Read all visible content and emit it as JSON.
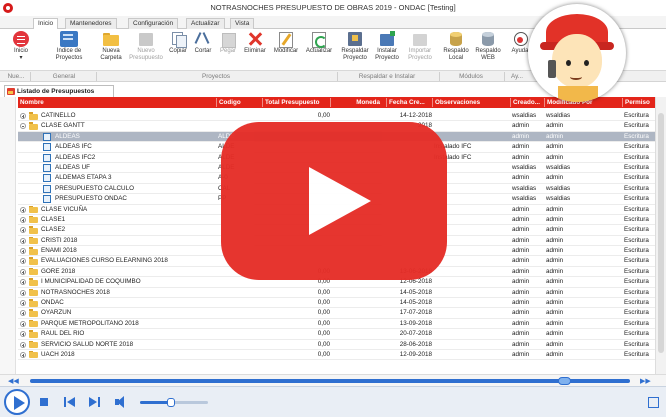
{
  "window": {
    "title": "NOTRASNOCHES PRESUPUESTO DE OBRAS 2019 - ONDAC [Testing]"
  },
  "tabs": [
    "Inicio",
    "Mantenedores",
    "Configuración",
    "Actualizar",
    "Vista"
  ],
  "ribbon": [
    {
      "label": "Inicio",
      "sub": "▾",
      "icon": "menu-circle-icon",
      "enabled": true
    },
    {
      "label": "Indice de",
      "sub": "Proyectos",
      "icon": "book-index-icon",
      "enabled": true
    },
    {
      "label": "Nueva",
      "sub": "Carpeta",
      "icon": "folder-icon",
      "enabled": true
    },
    {
      "label": "Nuevo",
      "sub": "Presupuesto",
      "icon": "new-budget-icon",
      "enabled": false
    },
    {
      "label": "Copiar",
      "sub": "",
      "icon": "copy-icon",
      "enabled": true
    },
    {
      "label": "Cortar",
      "sub": "",
      "icon": "scissors-icon",
      "enabled": true
    },
    {
      "label": "Pegar",
      "sub": "",
      "icon": "paste-icon",
      "enabled": false
    },
    {
      "label": "Eliminar",
      "sub": "",
      "icon": "delete-icon",
      "enabled": true
    },
    {
      "label": "Modificar",
      "sub": "",
      "icon": "edit-icon",
      "enabled": true
    },
    {
      "label": "Actualizar",
      "sub": "",
      "icon": "refresh-icon",
      "enabled": true
    },
    {
      "label": "Respaldar",
      "sub": "Proyecto",
      "icon": "backup-project-icon",
      "enabled": true
    },
    {
      "label": "Instalar",
      "sub": "Proyecto",
      "icon": "install-project-icon",
      "enabled": true
    },
    {
      "label": "Importar",
      "sub": "Proyecto",
      "icon": "import-project-icon",
      "enabled": false
    },
    {
      "label": "Respaldo",
      "sub": "Local",
      "icon": "local-backup-icon",
      "enabled": true
    },
    {
      "label": "Respaldo",
      "sub": "WEB",
      "icon": "web-backup-icon",
      "enabled": true
    },
    {
      "label": "Ayuda",
      "sub": "",
      "icon": "help-icon",
      "enabled": true
    }
  ],
  "groups": [
    "Nue...",
    "General",
    "Proyectos",
    "Respaldar e Instalar",
    "Módulos",
    "Ay..."
  ],
  "doc_tab": "Listado de Presupuestos",
  "columns": [
    "Nombre",
    "Codigo",
    "Total Presupuesto",
    "Moneda",
    "Fecha Cre...",
    "Observaciones",
    "Creado...",
    "Modificado Por",
    "Permiso"
  ],
  "rows": [
    {
      "name": "CATINELLO",
      "kind": "folder",
      "expander": "plus",
      "level": 0,
      "code": "",
      "total": "0,00",
      "moneda": "",
      "fecha": "14-12-2018",
      "obs": "",
      "creado": "wsaldias",
      "modificado": "wsaldias",
      "permiso": "Escritura"
    },
    {
      "name": "CLASE GANTT",
      "kind": "folder",
      "expander": "minus",
      "level": 0,
      "code": "",
      "total": "",
      "moneda": "",
      "fecha": "2018",
      "obs": "",
      "creado": "admin",
      "modificado": "admin",
      "permiso": "Escritura"
    },
    {
      "name": "ALDEAS",
      "kind": "doc",
      "expander": "",
      "level": 1,
      "code": "ALDE",
      "total": "",
      "moneda": "",
      "fecha": "",
      "obs": "",
      "creado": "admin",
      "modificado": "admin",
      "permiso": "Escritura",
      "selected": true
    },
    {
      "name": "ALDEAS IFC",
      "kind": "doc",
      "expander": "",
      "level": 1,
      "code": "ALDE",
      "total": "",
      "moneda": "",
      "fecha": "",
      "obs": "Instalado IFC",
      "creado": "admin",
      "modificado": "admin",
      "permiso": "Escritura"
    },
    {
      "name": "ALDEAS IFC2",
      "kind": "doc",
      "expander": "",
      "level": 1,
      "code": "ALDE",
      "total": "",
      "moneda": "",
      "fecha": "",
      "obs": "Instalado IFC",
      "creado": "admin",
      "modificado": "admin",
      "permiso": "Escritura"
    },
    {
      "name": "ALDEAS UF",
      "kind": "doc",
      "expander": "",
      "level": 1,
      "code": "ALDE",
      "total": "",
      "moneda": "",
      "fecha": "",
      "obs": "",
      "creado": "wsaldias",
      "modificado": "wsaldias",
      "permiso": "Escritura"
    },
    {
      "name": "ALDEMAS ETAPA 3",
      "kind": "doc",
      "expander": "",
      "level": 1,
      "code": "A-0",
      "total": "",
      "moneda": "",
      "fecha": "",
      "obs": "",
      "creado": "admin",
      "modificado": "admin",
      "permiso": "Escritura"
    },
    {
      "name": "PRESUPUESTO CALCULO",
      "kind": "doc",
      "expander": "",
      "level": 1,
      "code": "CAL",
      "total": "",
      "moneda": "",
      "fecha": "",
      "obs": "",
      "creado": "wsaldias",
      "modificado": "wsaldias",
      "permiso": "Escritura"
    },
    {
      "name": "PRESUPUESTO ONDAC",
      "kind": "doc",
      "expander": "",
      "level": 1,
      "code": "PP",
      "total": "",
      "moneda": "",
      "fecha": "",
      "obs": "",
      "creado": "wsaldias",
      "modificado": "wsaldias",
      "permiso": "Escritura"
    },
    {
      "name": "CLASE VICUÑA",
      "kind": "folder",
      "expander": "plus",
      "level": 0,
      "code": "",
      "total": "",
      "moneda": "",
      "fecha": "",
      "obs": "",
      "creado": "admin",
      "modificado": "admin",
      "permiso": "Escritura"
    },
    {
      "name": "CLASE1",
      "kind": "folder",
      "expander": "plus",
      "level": 0,
      "code": "",
      "total": "",
      "moneda": "",
      "fecha": "",
      "obs": "",
      "creado": "admin",
      "modificado": "admin",
      "permiso": "Escritura"
    },
    {
      "name": "CLASE2",
      "kind": "folder",
      "expander": "plus",
      "level": 0,
      "code": "",
      "total": "",
      "moneda": "",
      "fecha": "",
      "obs": "",
      "creado": "admin",
      "modificado": "admin",
      "permiso": "Escritura"
    },
    {
      "name": "CRISTI 2018",
      "kind": "folder",
      "expander": "plus",
      "level": 0,
      "code": "",
      "total": "",
      "moneda": "",
      "fecha": "",
      "obs": "",
      "creado": "admin",
      "modificado": "admin",
      "permiso": "Escritura"
    },
    {
      "name": "ENAMI 2018",
      "kind": "folder",
      "expander": "plus",
      "level": 0,
      "code": "",
      "total": "",
      "moneda": "",
      "fecha": "",
      "obs": "",
      "creado": "admin",
      "modificado": "admin",
      "permiso": "Escritura"
    },
    {
      "name": "EVALUACIONES CURSO ELEARNING 2018",
      "kind": "folder",
      "expander": "plus",
      "level": 0,
      "code": "",
      "total": "",
      "moneda": "",
      "fecha": "",
      "obs": "",
      "creado": "admin",
      "modificado": "admin",
      "permiso": "Escritura"
    },
    {
      "name": "GORE 2018",
      "kind": "folder",
      "expander": "plus",
      "level": 0,
      "code": "",
      "total": "0,00",
      "moneda": "",
      "fecha": "13-06-2018",
      "obs": "",
      "creado": "admin",
      "modificado": "admin",
      "permiso": "Escritura"
    },
    {
      "name": "I MUNICIPALIDAD DE COQUIMBO",
      "kind": "folder",
      "expander": "plus",
      "level": 0,
      "code": "",
      "total": "0,00",
      "moneda": "",
      "fecha": "12-06-2018",
      "obs": "",
      "creado": "admin",
      "modificado": "admin",
      "permiso": "Escritura"
    },
    {
      "name": "NOTRASNOCHES 2018",
      "kind": "folder",
      "expander": "plus",
      "level": 0,
      "code": "",
      "total": "0,00",
      "moneda": "",
      "fecha": "14-05-2018",
      "obs": "",
      "creado": "admin",
      "modificado": "admin",
      "permiso": "Escritura"
    },
    {
      "name": "ONDAC",
      "kind": "folder",
      "expander": "plus",
      "level": 0,
      "code": "",
      "total": "0,00",
      "moneda": "",
      "fecha": "14-05-2018",
      "obs": "",
      "creado": "admin",
      "modificado": "admin",
      "permiso": "Escritura"
    },
    {
      "name": "OYARZUN",
      "kind": "folder",
      "expander": "plus",
      "level": 0,
      "code": "",
      "total": "0,00",
      "moneda": "",
      "fecha": "17-07-2018",
      "obs": "",
      "creado": "admin",
      "modificado": "admin",
      "permiso": "Escritura"
    },
    {
      "name": "PARQUE METROPOLITANO 2018",
      "kind": "folder",
      "expander": "plus",
      "level": 0,
      "code": "",
      "total": "0,00",
      "moneda": "",
      "fecha": "13-09-2018",
      "obs": "",
      "creado": "admin",
      "modificado": "admin",
      "permiso": "Escritura"
    },
    {
      "name": "RAUL DEL RIO",
      "kind": "folder",
      "expander": "plus",
      "level": 0,
      "code": "",
      "total": "0,00",
      "moneda": "",
      "fecha": "20-07-2018",
      "obs": "",
      "creado": "admin",
      "modificado": "admin",
      "permiso": "Escritura"
    },
    {
      "name": "SERVICIO SALUD NORTE 2018",
      "kind": "folder",
      "expander": "plus",
      "level": 0,
      "code": "",
      "total": "0,00",
      "moneda": "",
      "fecha": "28-06-2018",
      "obs": "",
      "creado": "admin",
      "modificado": "admin",
      "permiso": "Escritura"
    },
    {
      "name": "UACH 2018",
      "kind": "folder",
      "expander": "plus",
      "level": 0,
      "code": "",
      "total": "0,00",
      "moneda": "",
      "fecha": "12-09-2018",
      "obs": "",
      "creado": "admin",
      "modificado": "admin",
      "permiso": "Escritura"
    }
  ],
  "media": {
    "progress": 0.89,
    "volume": 0.45
  },
  "colors": {
    "accent_red": "#e3251a",
    "selected_row": "#aeb6c3",
    "player_blue": "#2f6fd0",
    "youtube_red": "#e52d27"
  }
}
